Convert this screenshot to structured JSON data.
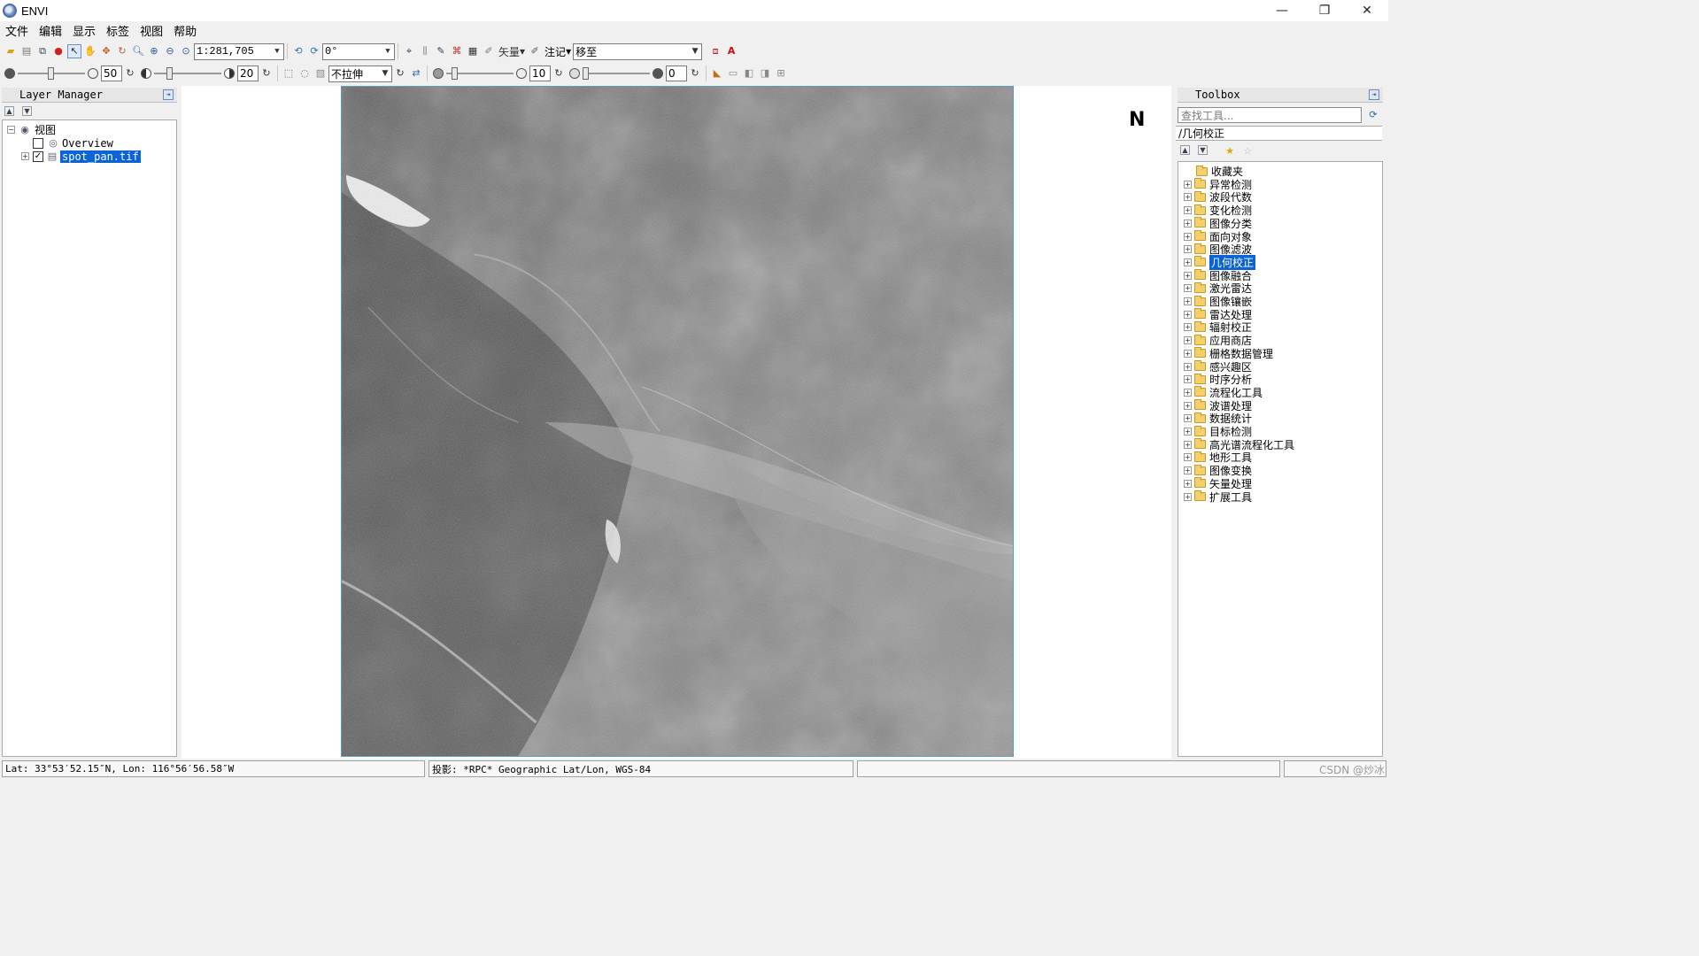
{
  "window": {
    "title": "ENVI",
    "minimize": "—",
    "restore": "❐",
    "close": "✕"
  },
  "menu": [
    "文件",
    "编辑",
    "显示",
    "标签",
    "视图",
    "帮助"
  ],
  "toolbar1": {
    "zoom_scale": "1:281,705",
    "rotation": "0°",
    "vector_label": "矢量",
    "annotation_label": "注记",
    "goto_value": "移至"
  },
  "toolbar2": {
    "brightness": "50",
    "contrast": "20",
    "stretch": "不拉伸",
    "sharpen": "10",
    "transparency": "0"
  },
  "layer_manager": {
    "title": "Layer Manager",
    "root": "视图",
    "items": [
      {
        "label": "Overview",
        "checked": false
      },
      {
        "label": "spot_pan.tif",
        "checked": true,
        "selected": true
      }
    ]
  },
  "toolbox": {
    "title": "Toolbox",
    "search_placeholder": "查找工具...",
    "path": "/几何校正",
    "items": [
      "收藏夹",
      "异常检测",
      "波段代数",
      "变化检测",
      "图像分类",
      "面向对象",
      "图像滤波",
      "几何校正",
      "图像融合",
      "激光雷达",
      "图像镶嵌",
      "雷达处理",
      "辐射校正",
      "应用商店",
      "栅格数据管理",
      "感兴趣区",
      "时序分析",
      "流程化工具",
      "波谱处理",
      "数据统计",
      "目标检测",
      "高光谱流程化工具",
      "地形工具",
      "图像变换",
      "矢量处理",
      "扩展工具"
    ],
    "selected": "几何校正"
  },
  "statusbar": {
    "coords": "Lat: 33°53′52.15″N, Lon: 116°56′56.58″W",
    "projection": "投影: *RPC* Geographic Lat/Lon, WGS-84",
    "watermark": "CSDN @炒冰"
  },
  "north_arrow": "N"
}
